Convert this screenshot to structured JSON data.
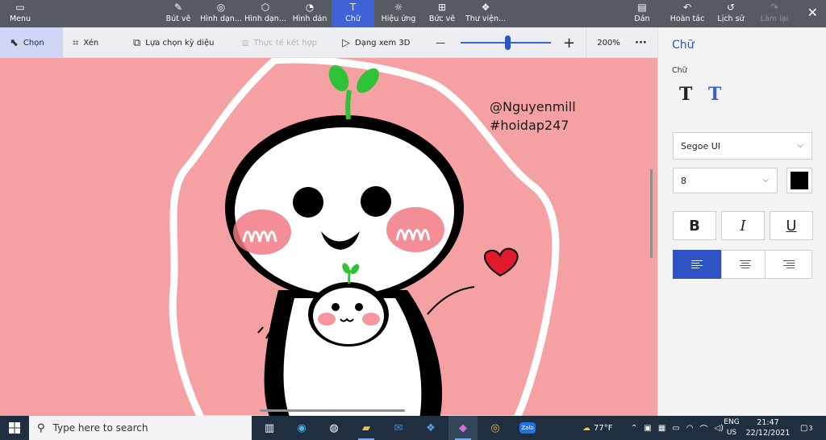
{
  "ribbon": {
    "menu": "Menu",
    "brushes": "Bút vẽ",
    "shapes2d": "Hình dạn...",
    "shapes3d": "Hình dạn...",
    "stickers": "Hình dán",
    "text": "Chữ",
    "effects": "Hiệu ứng",
    "canvas": "Bức vẽ",
    "library": "Thư viện...",
    "paste": "Dán",
    "undo": "Hoàn tác",
    "history": "Lịch sử",
    "redo": "Làm lại"
  },
  "toolbar": {
    "select": "Chọn",
    "crop": "Xén",
    "magic_select": "Lựa chọn kỳ diệu",
    "mixed_reality": "Thực tế kết hợp",
    "view_3d": "Dạng xem 3D",
    "zoom_minus": "—",
    "zoom_plus": "+",
    "zoom_level": "200%",
    "zoom_fraction": 0.52,
    "more": "···"
  },
  "canvas": {
    "watermark_line1": "@Nguyenmill",
    "watermark_line2": "#hoidap247",
    "background_color": "#f5a0a2"
  },
  "panel": {
    "title": "Chữ",
    "subtitle": "Chữ",
    "font_name": "Segoe UI",
    "font_size": "8",
    "text_color": "#000000",
    "bold": "B",
    "italic": "I",
    "underline": "U",
    "alignment_selected": "left"
  },
  "taskbar": {
    "search_placeholder": "Type here to search",
    "weather": "77°F",
    "lang_line1": "ENG",
    "lang_line2": "US",
    "time": "21:47",
    "date": "22/12/2021",
    "notifications": "3"
  },
  "colors": {
    "accent": "#3f63d6",
    "ribbon_bg": "#555a63",
    "taskbar_bg": "#202f3f"
  }
}
